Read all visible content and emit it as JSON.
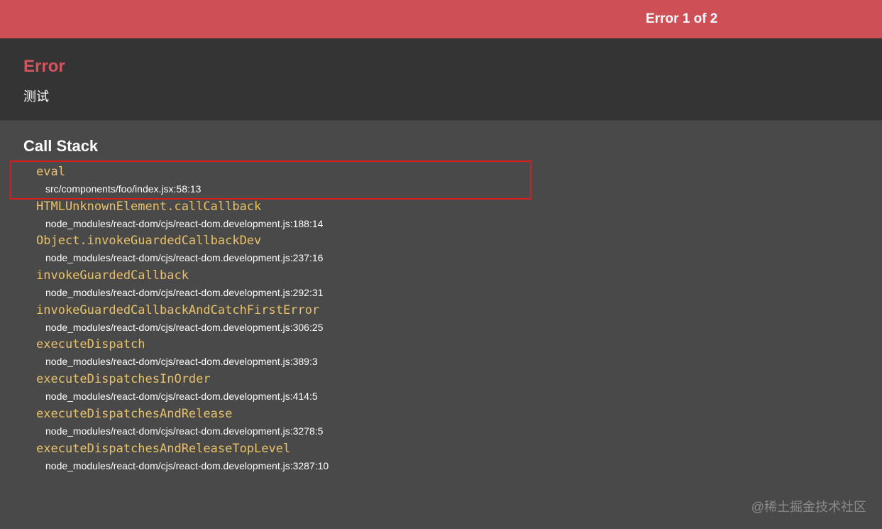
{
  "topbar": {
    "counter": "Error 1 of 2",
    "color": "#cf4f57"
  },
  "error": {
    "title": "Error",
    "message": "测试",
    "title_color": "#d8545d"
  },
  "call_stack": {
    "heading": "Call Stack",
    "frames": [
      {
        "function": "eval",
        "location": "src/components/foo/index.jsx:58:13"
      },
      {
        "function": "HTMLUnknownElement.callCallback",
        "location": "node_modules/react-dom/cjs/react-dom.development.js:188:14"
      },
      {
        "function": "Object.invokeGuardedCallbackDev",
        "location": "node_modules/react-dom/cjs/react-dom.development.js:237:16"
      },
      {
        "function": "invokeGuardedCallback",
        "location": "node_modules/react-dom/cjs/react-dom.development.js:292:31"
      },
      {
        "function": "invokeGuardedCallbackAndCatchFirstError",
        "location": "node_modules/react-dom/cjs/react-dom.development.js:306:25"
      },
      {
        "function": "executeDispatch",
        "location": "node_modules/react-dom/cjs/react-dom.development.js:389:3"
      },
      {
        "function": "executeDispatchesInOrder",
        "location": "node_modules/react-dom/cjs/react-dom.development.js:414:5"
      },
      {
        "function": "executeDispatchesAndRelease",
        "location": "node_modules/react-dom/cjs/react-dom.development.js:3278:5"
      },
      {
        "function": "executeDispatchesAndReleaseTopLevel",
        "location": "node_modules/react-dom/cjs/react-dom.development.js:3287:10"
      }
    ],
    "function_color": "#e8c168",
    "highlight_color": "#d41e1e"
  },
  "watermark": "@稀土掘金技术社区"
}
